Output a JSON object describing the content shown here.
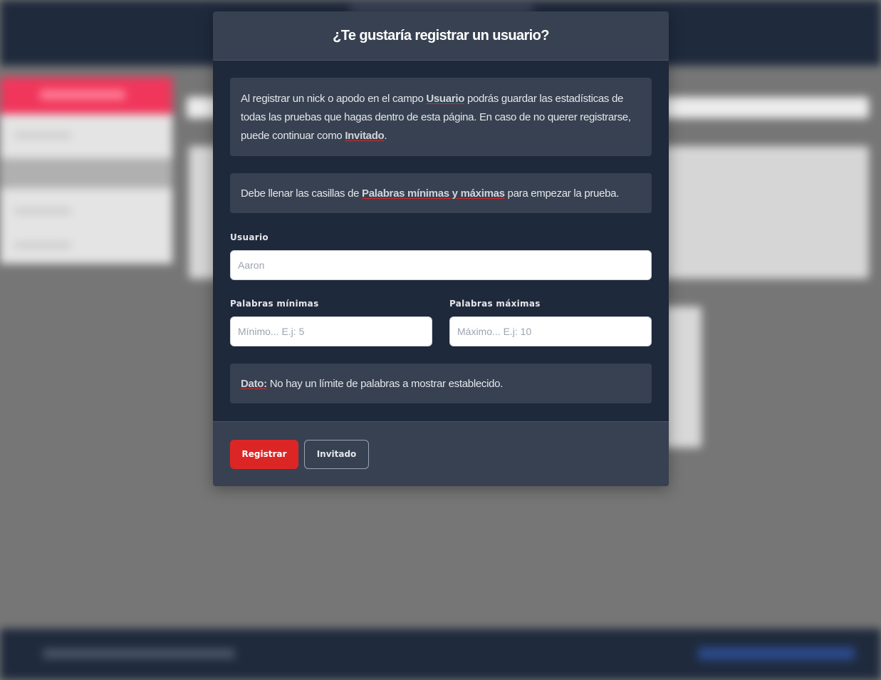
{
  "modal": {
    "title": "¿Te gustaría registrar un usuario?",
    "info1": {
      "text_a": "Al registrar un nick o apodo en el campo ",
      "hl_a": "Usuario",
      "text_b": " podrás guardar las estadísticas de todas las pruebas que hagas dentro de esta página. En caso de no querer registrarse, puede continuar como ",
      "hl_b": "Invitado",
      "text_c": "."
    },
    "info2": {
      "text_a": "Debe llenar las casillas de ",
      "hl_a": "Palabras mínimas y máximas",
      "text_b": " para empezar la prueba."
    },
    "usuario": {
      "label": "Usuario",
      "placeholder": "Aaron",
      "value": ""
    },
    "min": {
      "label": "Palabras mínimas",
      "placeholder": "Mínimo... E.j: 5",
      "value": ""
    },
    "max": {
      "label": "Palabras máximas",
      "placeholder": "Máximo... E.j: 10",
      "value": ""
    },
    "dato": {
      "hl": "Dato:",
      "text": " No hay un límite de palabras a mostrar establecido."
    },
    "buttons": {
      "register": "Registrar",
      "guest": "Invitado"
    }
  },
  "colors": {
    "modal_bg": "#1e293b",
    "panel_bg": "#374151",
    "primary": "#dc2626",
    "overlay": "#777777"
  }
}
